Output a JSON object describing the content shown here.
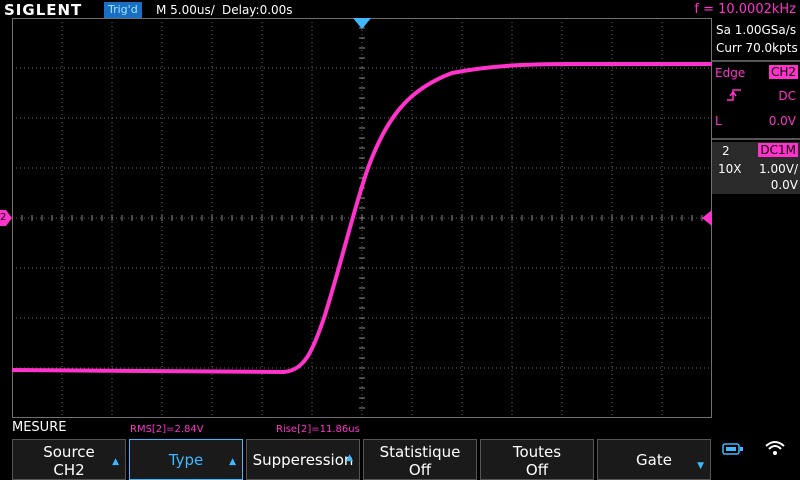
{
  "header": {
    "brand": "SIGLENT",
    "trigger_status": "Trig'd",
    "timebase": "M 5.00us/",
    "delay": "Delay:0.00s",
    "frequency": "f = 10.0002kHz"
  },
  "acquisition": {
    "sample_rate": "Sa 1.00GSa/s",
    "memory": "Curr 70.0kpts"
  },
  "trigger": {
    "type_label": "Edge",
    "source": "CH2",
    "coupling": "DC",
    "level_label": "L",
    "level": "0.0V",
    "slope_icon": "rising-edge-icon"
  },
  "channel": {
    "number": "2",
    "coupling": "DC1M",
    "probe": "10X",
    "scale": "1.00V/",
    "offset": "0.0V",
    "color": "#ff33cc"
  },
  "measure": {
    "title": "MESURE",
    "items": [
      "RMS[2]=2.84V",
      "Rise[2]=11.86us"
    ]
  },
  "softkeys": [
    {
      "line1": "Source",
      "line2": "CH2"
    },
    {
      "line1": "Type"
    },
    {
      "line1": "Supperession"
    },
    {
      "line1": "Statistique",
      "line2": "Off"
    },
    {
      "line1": "Toutes",
      "line2": "Off"
    },
    {
      "line1": "Gate"
    }
  ],
  "markers": {
    "channel_marker": "2"
  },
  "colors": {
    "trace": "#ff33cc",
    "accent": "#3fb8ff",
    "trigger_bar": "#1a6fc2"
  },
  "icons": [
    "usb-icon",
    "wifi-icon",
    "trigger-position-icon",
    "trigger-level-icon"
  ]
}
